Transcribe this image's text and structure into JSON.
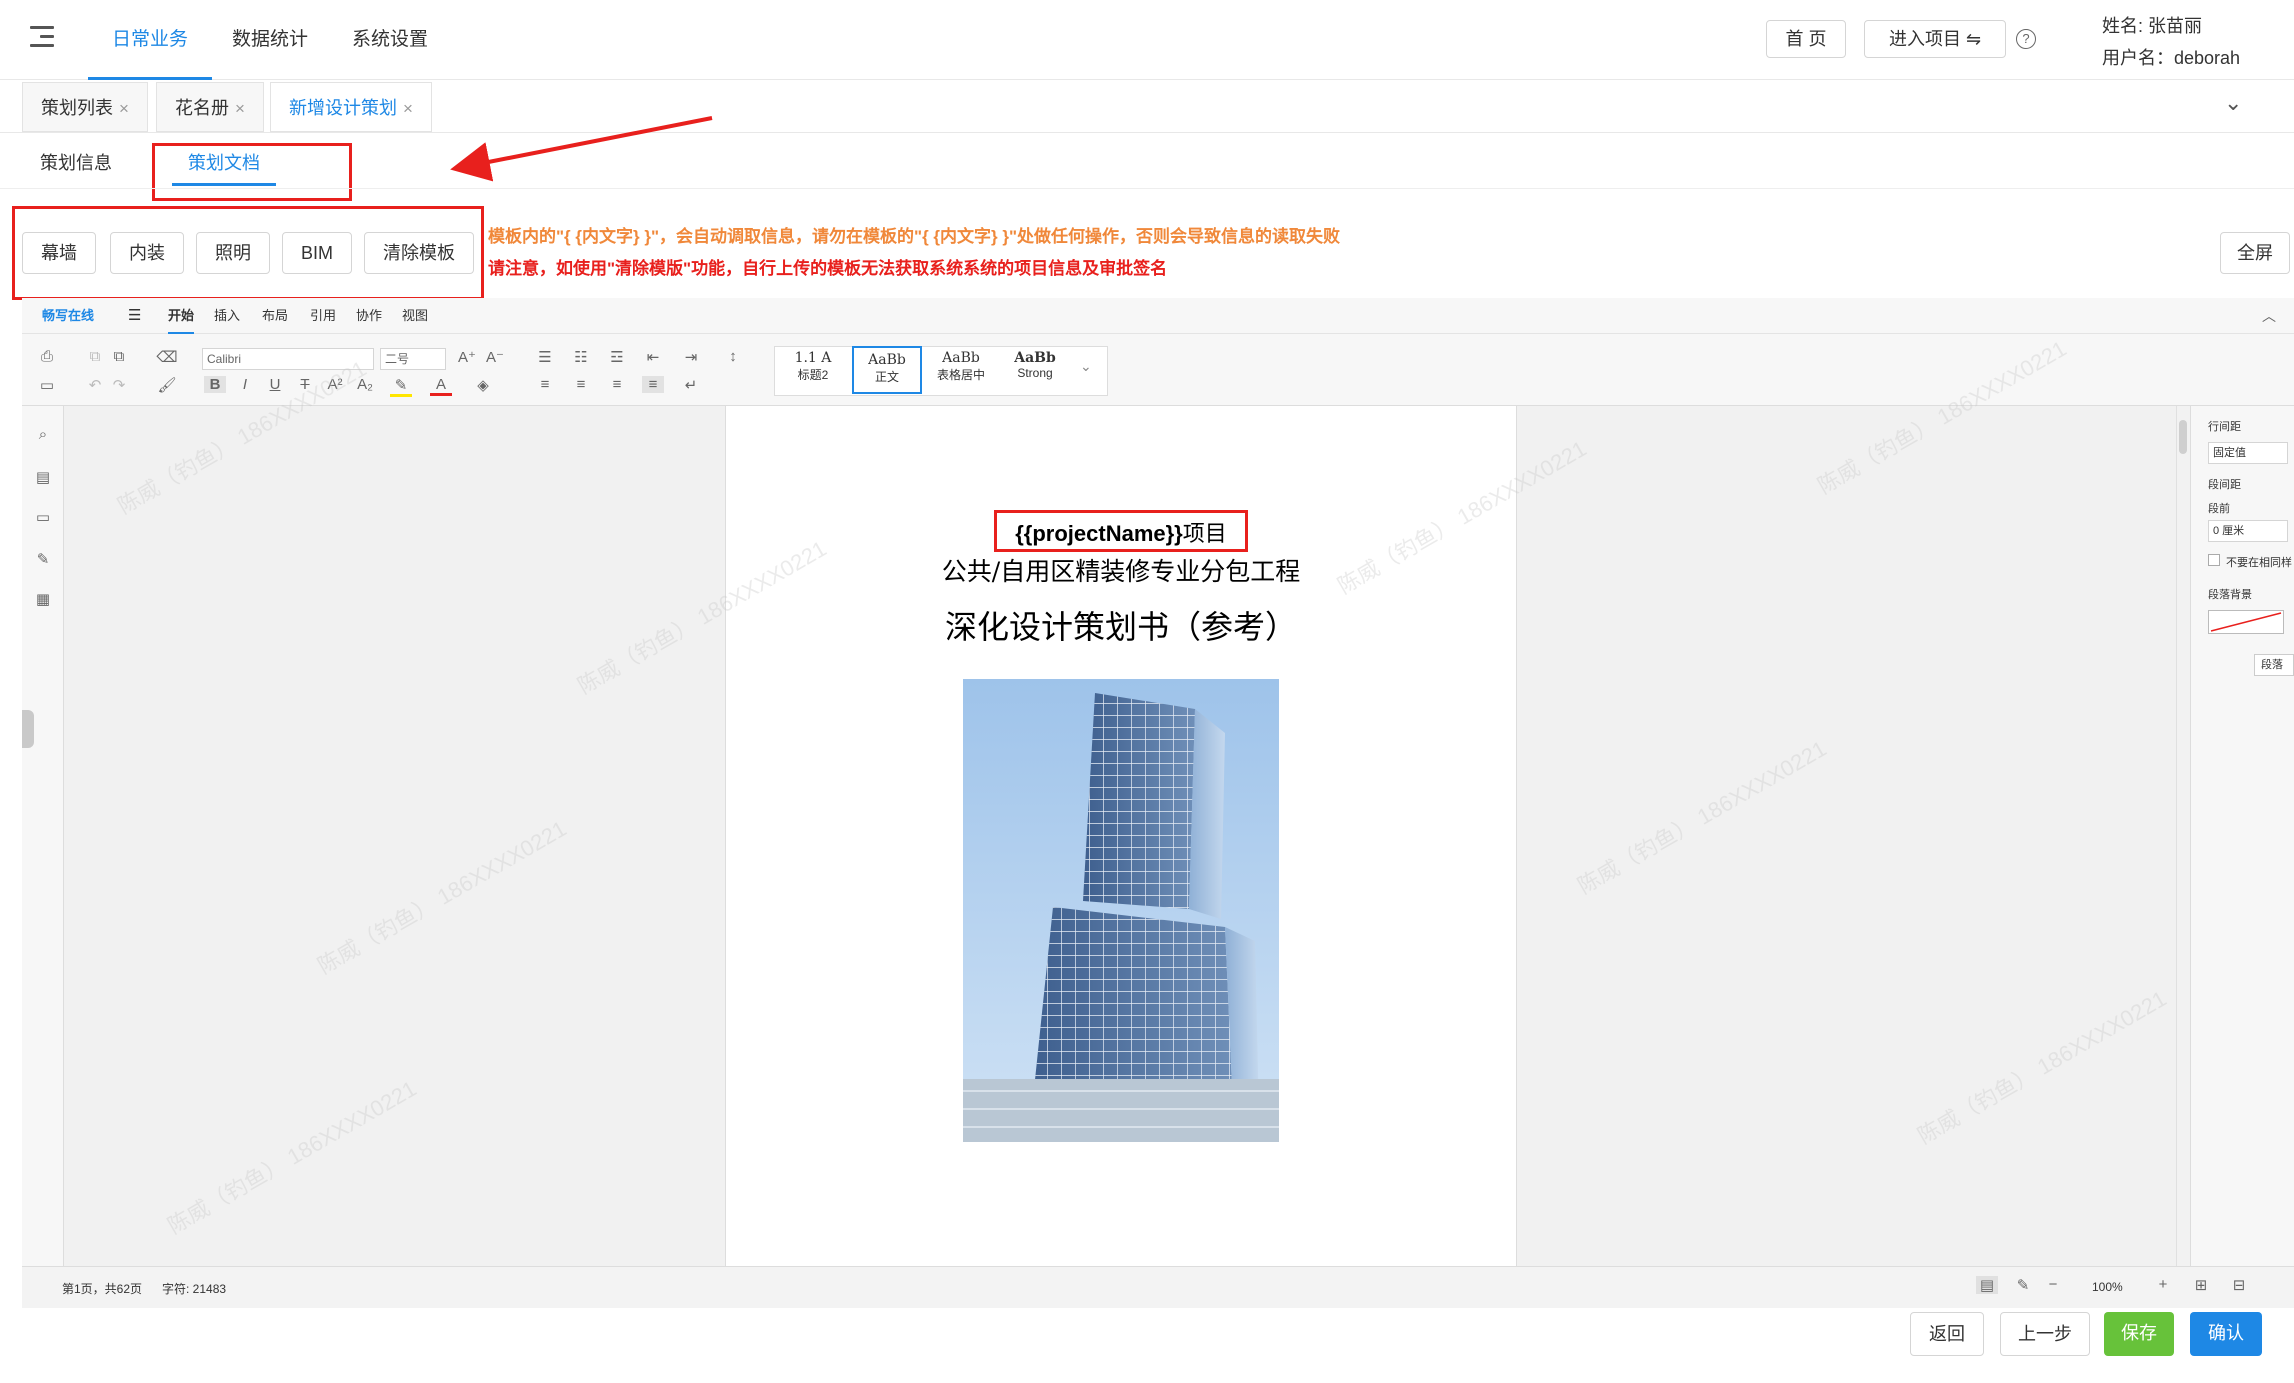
{
  "nav": {
    "tabs": [
      "日常业务",
      "数据统计",
      "系统设置"
    ],
    "home_label": "首 页",
    "enter_project_label": "进入项目 ⇋",
    "help_icon": "?",
    "user_name_line": "姓名: 张苗丽",
    "user_account_line": "用户名：deborah",
    "collapse_icon": "⌄"
  },
  "page_tabs": [
    {
      "label": "策划列表",
      "close": "×"
    },
    {
      "label": "花名册",
      "close": "×"
    },
    {
      "label": "新增设计策划",
      "close": "×"
    }
  ],
  "sub_tabs": [
    "策划信息",
    "策划文档"
  ],
  "template_buttons": [
    "幕墙",
    "内装",
    "照明",
    "BIM",
    "清除模板"
  ],
  "notes": {
    "line1": "模板内的\"{ {内文字} }\"，会自动调取信息，请勿在模板的\"{ {内文字} }\"处做任何操作，否则会导致信息的读取失败",
    "line2": "请注意，如使用\"清除模版\"功能，自行上传的模板无法获取系统系统的项目信息及审批签名"
  },
  "fullscreen_label": "全屏",
  "editor": {
    "brand": "畅写在线",
    "menu_icon": "☰",
    "menus": [
      "开始",
      "插入",
      "布局",
      "引用",
      "协作",
      "视图"
    ],
    "font_name": "Calibri",
    "font_size": "二号",
    "styles": [
      {
        "preview": "1.1 A",
        "name": "标题2"
      },
      {
        "preview": "AaBb",
        "name": "正文"
      },
      {
        "preview": "AaBb",
        "name": "表格居中"
      },
      {
        "preview": "AaBb",
        "name": "Strong"
      }
    ],
    "right_panel": {
      "line_spacing_label": "行间距",
      "line_spacing_value": "固定值",
      "para_spacing_label": "段间距",
      "before_label": "段前",
      "before_value": "0 厘米",
      "no_space_label": "不要在相同样",
      "shading_label": "段落背景",
      "para_btn": "段落"
    },
    "status": {
      "page_info": "第1页，共62页",
      "word_count": "字符: 21483",
      "zoom": "100%"
    },
    "document": {
      "placeholder": "{{projectName}}",
      "placeholder_suffix": "项目",
      "subtitle": "公共/自用区精装修专业分包工程",
      "title": "深化设计策划书（参考）"
    },
    "watermark": "陈威（钓鱼） 186XXXX0221"
  },
  "footer": {
    "back_label": "返回",
    "prev_label": "上一步",
    "save_label": "保存",
    "confirm_label": "确认"
  },
  "colors": {
    "primary": "#1e88e5",
    "annotation_red": "#e8201d",
    "note_orange": "#f0883a",
    "save_green": "#67c23a"
  }
}
